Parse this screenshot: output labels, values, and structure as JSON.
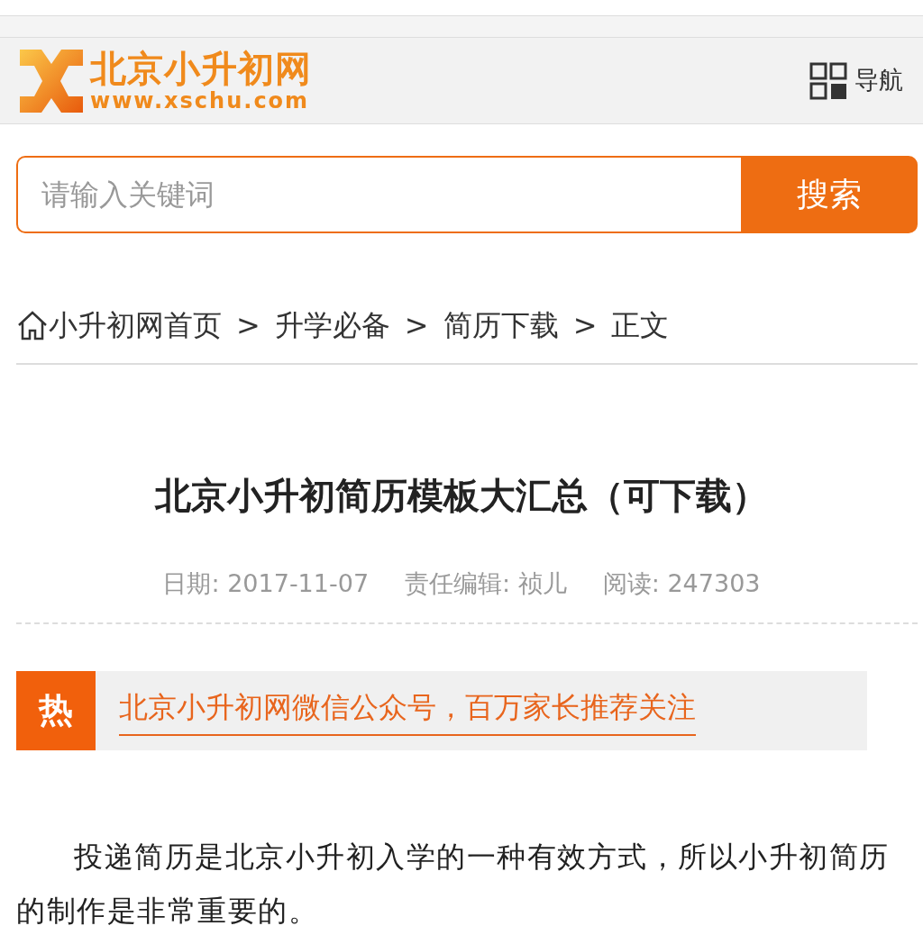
{
  "header": {
    "logo_title": "北京小升初网",
    "logo_url": "www.xschu.com",
    "nav_label": "导航"
  },
  "search": {
    "placeholder": "请输入关键词",
    "button": "搜索"
  },
  "breadcrumb": {
    "items": [
      {
        "label": "小升初网首页"
      },
      {
        "label": "升学必备"
      },
      {
        "label": "简历下载"
      },
      {
        "label": "正文"
      }
    ],
    "separators": [
      ">",
      ">",
      ">"
    ]
  },
  "article": {
    "title": "北京小升初简历模板大汇总（可下载）",
    "meta": [
      "日期: 2017-11-07",
      "责任编辑: 祯儿",
      "阅读: 247303"
    ],
    "hot": {
      "tag": "热",
      "link": "北京小升初网微信公众号，百万家长推荐关注"
    },
    "paragraphs": [
      "投递简历是北京小升初入学的一种有效方式，所以小升初简历的制作是非常重要的。"
    ]
  }
}
